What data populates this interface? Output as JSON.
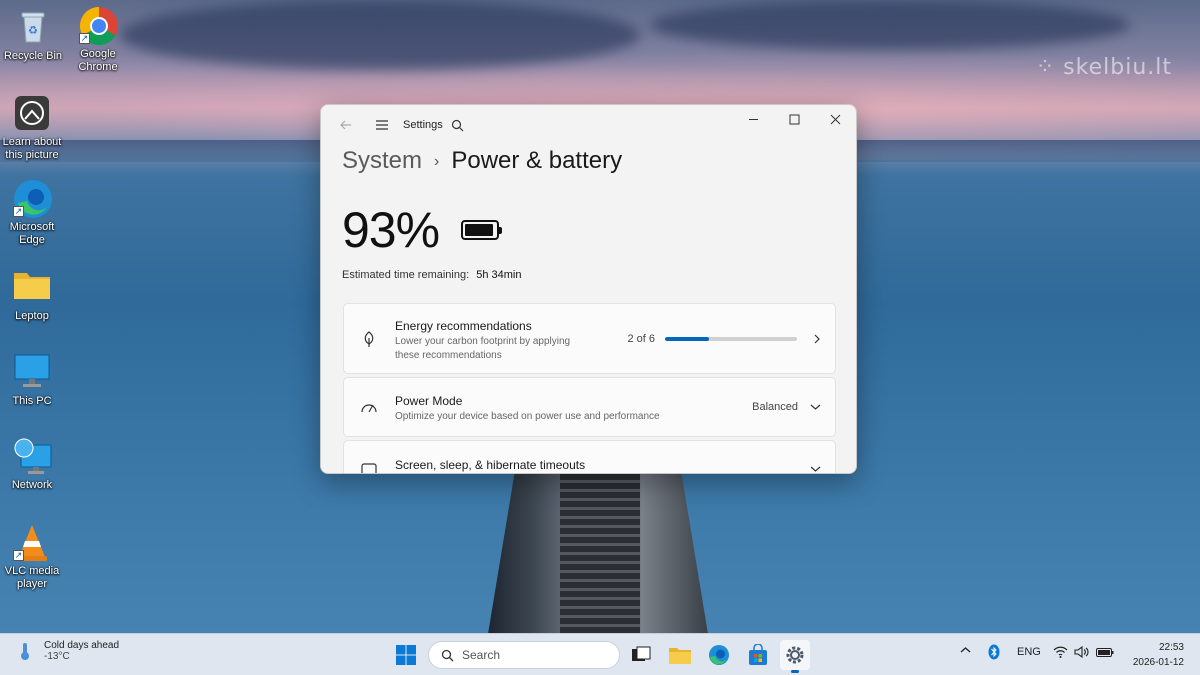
{
  "desktop": {
    "icons": [
      {
        "label": "Recycle Bin",
        "icon": "recycle-bin-icon"
      },
      {
        "label": "Google Chrome",
        "icon": "chrome-icon"
      },
      {
        "label": "Learn about this picture",
        "icon": "learn-about-picture-icon"
      },
      {
        "label": "Microsoft Edge",
        "icon": "edge-icon"
      },
      {
        "label": "Leptop",
        "icon": "folder-icon"
      },
      {
        "label": "This PC",
        "icon": "monitor-icon"
      },
      {
        "label": "Network",
        "icon": "network-icon"
      },
      {
        "label": "VLC media player",
        "icon": "vlc-icon"
      }
    ],
    "watermark": "skelbiu.lt"
  },
  "settings": {
    "app_title": "Settings",
    "breadcrumb": {
      "root": "System",
      "separator": "›",
      "current": "Power & battery"
    },
    "battery_percent": "93%",
    "battery_level": 0.93,
    "estimated": {
      "label": "Estimated time remaining:",
      "value": "5h 34min"
    },
    "cards": {
      "energy": {
        "title": "Energy recommendations",
        "subtitle_line1": "Lower your carbon footprint by applying",
        "subtitle_line2": "these recommendations",
        "count": "2 of 6",
        "progress": 0.33
      },
      "power_mode": {
        "title": "Power Mode",
        "subtitle": "Optimize your device based on power use and performance",
        "value": "Balanced"
      },
      "timeouts": {
        "title": "Screen, sleep, & hibernate timeouts"
      }
    }
  },
  "taskbar": {
    "weather": {
      "title": "Cold days ahead",
      "temp": "-13°C"
    },
    "search_placeholder": "Search",
    "language": "ENG",
    "time": "22:53",
    "date": "2026-01-12"
  },
  "colors": {
    "accent": "#0067c0",
    "taskbar_bg": "#dfe6ef",
    "window_bg": "#f3f3f3"
  }
}
